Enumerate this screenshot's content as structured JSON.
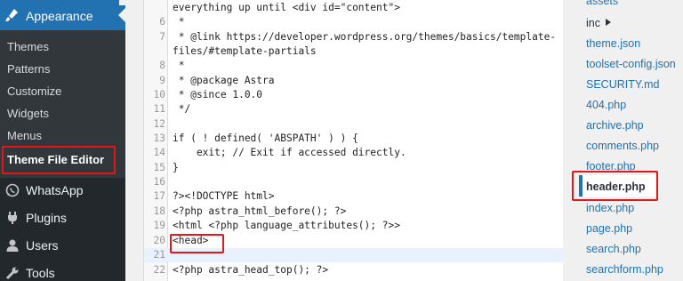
{
  "sidebar": {
    "appearance_label": "Appearance",
    "submenu": [
      "Themes",
      "Patterns",
      "Customize",
      "Widgets",
      "Menus",
      "Theme File Editor"
    ],
    "items": [
      {
        "label": "WhatsApp",
        "icon": "whatsapp-icon"
      },
      {
        "label": "Plugins",
        "icon": "plugins-icon"
      },
      {
        "label": "Users",
        "icon": "users-icon"
      },
      {
        "label": "Tools",
        "icon": "tools-icon"
      }
    ]
  },
  "editor": {
    "lines": [
      {
        "num": "",
        "text": "everything up until <div id=\"content\">"
      },
      {
        "num": "6",
        "text": " *"
      },
      {
        "num": "7",
        "text": " * @link https://developer.wordpress.org/themes/basics/template-"
      },
      {
        "num": "",
        "text": "files/#template-partials"
      },
      {
        "num": "8",
        "text": " *"
      },
      {
        "num": "9",
        "text": " * @package Astra"
      },
      {
        "num": "10",
        "text": " * @since 1.0.0"
      },
      {
        "num": "11",
        "text": " */"
      },
      {
        "num": "12",
        "text": ""
      },
      {
        "num": "13",
        "text": "if ( ! defined( 'ABSPATH' ) ) {"
      },
      {
        "num": "14",
        "text": "    exit; // Exit if accessed directly."
      },
      {
        "num": "15",
        "text": "}"
      },
      {
        "num": "16",
        "text": ""
      },
      {
        "num": "17",
        "text": "?><!DOCTYPE html>"
      },
      {
        "num": "18",
        "text": "<?php astra_html_before(); ?>"
      },
      {
        "num": "19",
        "text": "<html <?php language_attributes(); ?>>"
      },
      {
        "num": "20",
        "text": "<head>"
      },
      {
        "num": "21",
        "text": ""
      },
      {
        "num": "22",
        "text": "<?php astra_head_top(); ?>"
      }
    ]
  },
  "files": {
    "items": [
      "assets",
      "inc",
      "theme.json",
      "toolset-config.json",
      "SECURITY.md",
      "404.php",
      "archive.php",
      "comments.php",
      "footer.php",
      "header.php",
      "index.php",
      "page.php",
      "search.php",
      "searchform.php"
    ],
    "selected": "header.php"
  },
  "colors": {
    "highlight": "#e4161a",
    "accent": "#2271b1",
    "sidebar": "#23282d"
  }
}
